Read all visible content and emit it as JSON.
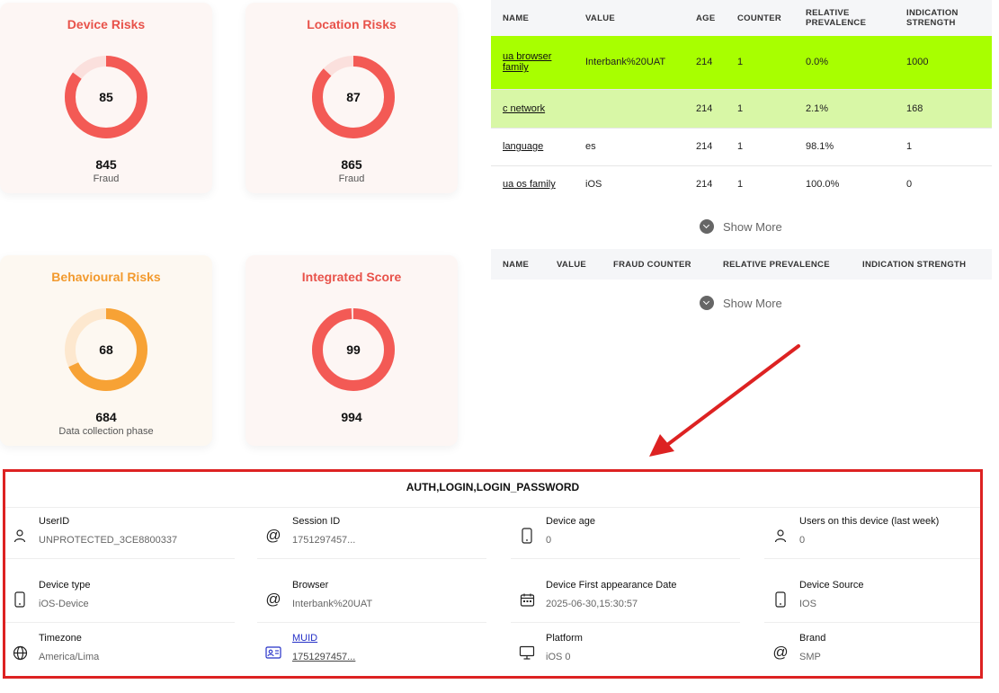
{
  "cards": {
    "device": {
      "title": "Device Risks",
      "score": "85",
      "num": "845",
      "sub": "Fraud",
      "percent": 0.85,
      "color": "#f35a55",
      "track": "#fbe0dd"
    },
    "location": {
      "title": "Location Risks",
      "score": "87",
      "num": "865",
      "sub": "Fraud",
      "percent": 0.87,
      "color": "#f35a55",
      "track": "#fbe0dd"
    },
    "behaviour": {
      "title": "Behavioural Risks",
      "score": "68",
      "num": "684",
      "sub": "Data collection phase",
      "percent": 0.68,
      "color": "#f7a235",
      "track": "#fde8cf"
    },
    "integrated": {
      "title": "Integrated Score",
      "score": "99",
      "num": "994",
      "sub": "",
      "percent": 0.99,
      "color": "#f35a55",
      "track": "#fbe0dd"
    }
  },
  "table1": {
    "headers": {
      "name": "NAME",
      "value": "VALUE",
      "age": "AGE",
      "counter": "COUNTER",
      "prev": "RELATIVE PREVALENCE",
      "strength": "INDICATION STRENGTH"
    },
    "rows": [
      {
        "name": "ua browser family",
        "value": "Interbank%20UAT",
        "age": "214",
        "counter": "1",
        "prev": "0.0%",
        "strength": "1000"
      },
      {
        "name": "c network",
        "value": "",
        "age": "214",
        "counter": "1",
        "prev": "2.1%",
        "strength": "168"
      },
      {
        "name": "language",
        "value": "es",
        "age": "214",
        "counter": "1",
        "prev": "98.1%",
        "strength": "1"
      },
      {
        "name": "ua os family",
        "value": "iOS",
        "age": "214",
        "counter": "1",
        "prev": "100.0%",
        "strength": "0"
      }
    ],
    "show_more": "Show More"
  },
  "table2": {
    "headers": {
      "name": "NAME",
      "value": "VALUE",
      "fraud_counter": "FRAUD COUNTER",
      "prev": "RELATIVE PREVALENCE",
      "strength": "INDICATION STRENGTH"
    },
    "show_more": "Show More"
  },
  "details": {
    "title": "AUTH,LOGIN,LOGIN_PASSWORD",
    "items": [
      {
        "label": "UserID",
        "value": "UNPROTECTED_3CE8800337",
        "icon": "user-icon"
      },
      {
        "label": "Session ID",
        "value": "1751297457...",
        "icon": "at-icon"
      },
      {
        "label": "Device age",
        "value": "0",
        "icon": "phone-icon"
      },
      {
        "label": "Users on this device (last week)",
        "value": "0",
        "icon": "user-icon"
      },
      {
        "label": "Device type",
        "value": "iOS-Device",
        "icon": "phone-icon"
      },
      {
        "label": "Browser",
        "value": "Interbank%20UAT",
        "icon": "at-icon"
      },
      {
        "label": "Device First appearance Date",
        "value": "2025-06-30,15:30:57",
        "icon": "calendar-icon"
      },
      {
        "label": "Device Source",
        "value": "IOS",
        "icon": "phone-icon"
      },
      {
        "label": "Timezone",
        "value": "America/Lima",
        "icon": "globe-icon"
      },
      {
        "label": "MUID",
        "value": "1751297457...",
        "icon": "id-card-icon"
      },
      {
        "label": "Platform",
        "value": "iOS 0",
        "icon": "monitor-icon"
      },
      {
        "label": "Brand",
        "value": "SMP",
        "icon": "at-icon"
      }
    ]
  },
  "colors": {
    "highlight_red": "#dd2222",
    "row_green": "#a8ff00",
    "row_lightgreen": "#d8f7a6"
  }
}
